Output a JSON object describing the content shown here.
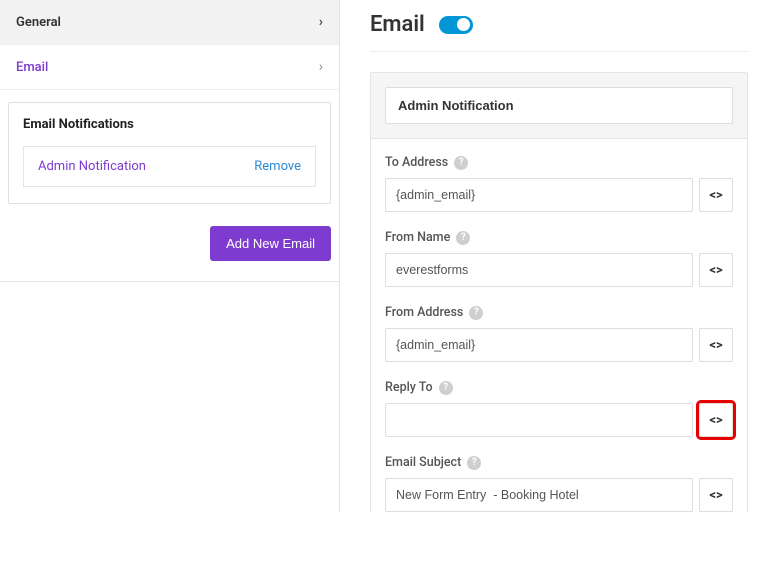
{
  "sidebar": {
    "general_label": "General",
    "email_label": "Email",
    "panel_title": "Email Notifications",
    "notif_name": "Admin Notification",
    "remove_label": "Remove",
    "add_button": "Add New Email"
  },
  "main": {
    "title": "Email",
    "toggle_on": true,
    "notification_name": "Admin Notification",
    "fields": {
      "to_address": {
        "label": "To Address",
        "value": "{admin_email}"
      },
      "from_name": {
        "label": "From Name",
        "value": "everestforms"
      },
      "from_address": {
        "label": "From Address",
        "value": "{admin_email}"
      },
      "reply_to": {
        "label": "Reply To",
        "value": ""
      },
      "email_subject": {
        "label": "Email Subject",
        "value": "New Form Entry  - Booking Hotel"
      }
    }
  }
}
